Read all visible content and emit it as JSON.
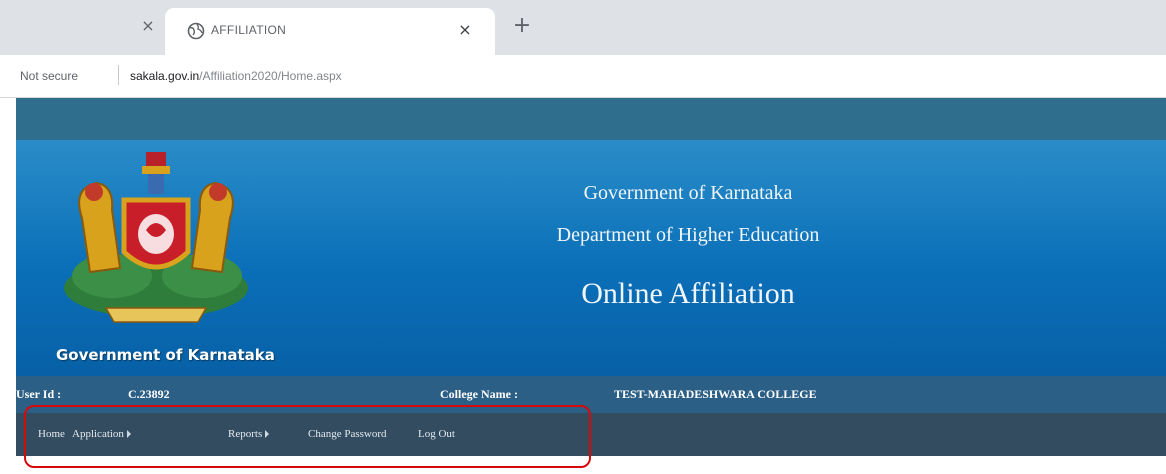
{
  "browser": {
    "tab_title": "AFFILIATION",
    "tab_close": "×",
    "prev_tab_close": "×",
    "new_tab": "+",
    "security_status": "Not secure",
    "url_domain": "sakala.gov.in",
    "url_path": "/Affiliation2020/Home.aspx"
  },
  "header": {
    "emblem_caption": "Government of Karnataka",
    "line1": "Government of Karnataka",
    "line2": "Department of Higher Education",
    "line3": "Online Affiliation"
  },
  "info": {
    "user_id_label": "User Id :",
    "user_id_value": "C.23892",
    "college_label": "College Name :",
    "college_value": "TEST-MAHADESHWARA COLLEGE"
  },
  "nav": {
    "home": "Home",
    "application": "Application",
    "reports": "Reports",
    "change_password": "Change Password",
    "logout": "Log Out"
  },
  "colors": {
    "banner_blue": "#0a6fb8",
    "info_bar": "#2c5f86",
    "nav_bar": "#334c60",
    "highlight_red": "#d60a0a"
  }
}
